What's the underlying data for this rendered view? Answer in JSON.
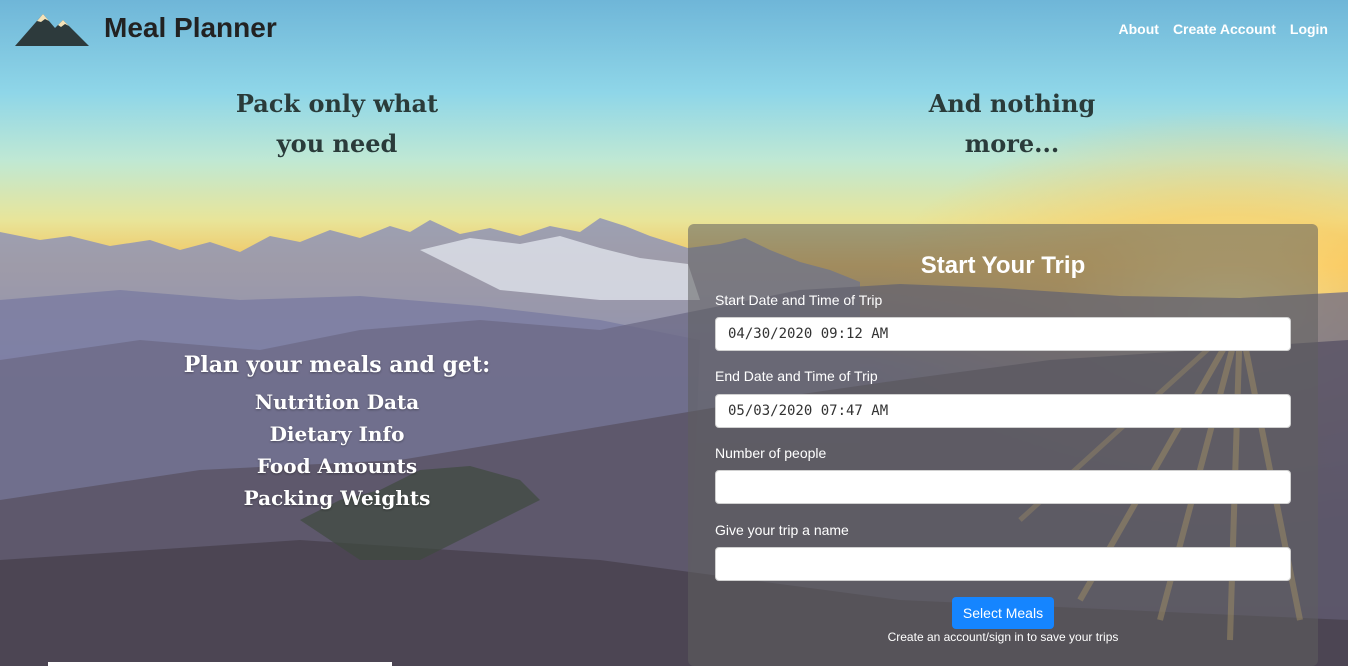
{
  "app": {
    "brand_name": "Meal Planner",
    "logo_icon": "mountain-logo-icon"
  },
  "nav": {
    "items": [
      {
        "label": "About"
      },
      {
        "label": "Create Account"
      },
      {
        "label": "Login"
      }
    ]
  },
  "hero": {
    "tagline_left": {
      "line1": "Pack only what",
      "line2": "you need"
    },
    "tagline_right": {
      "line1": "And nothing",
      "line2": "more..."
    },
    "benefits_heading": "Plan your meals and get:",
    "benefits": [
      "Nutrition Data",
      "Dietary Info",
      "Food Amounts",
      "Packing Weights"
    ]
  },
  "trip_form": {
    "title": "Start Your Trip",
    "start_label": "Start Date and Time of Trip",
    "start_value": "04/30/2020 09:12 AM",
    "end_label": "End Date and Time of Trip",
    "end_value": "05/03/2020 07:47 AM",
    "people_label": "Number of people",
    "people_value": "",
    "name_label": "Give your trip a name",
    "name_value": "",
    "submit_label": "Select Meals",
    "note": "Create an account/sign in to save your trips"
  },
  "colors": {
    "primary_button": "#1585ff",
    "brand_text": "#222222",
    "card_overlay": "rgba(95,95,95,0.55)"
  }
}
